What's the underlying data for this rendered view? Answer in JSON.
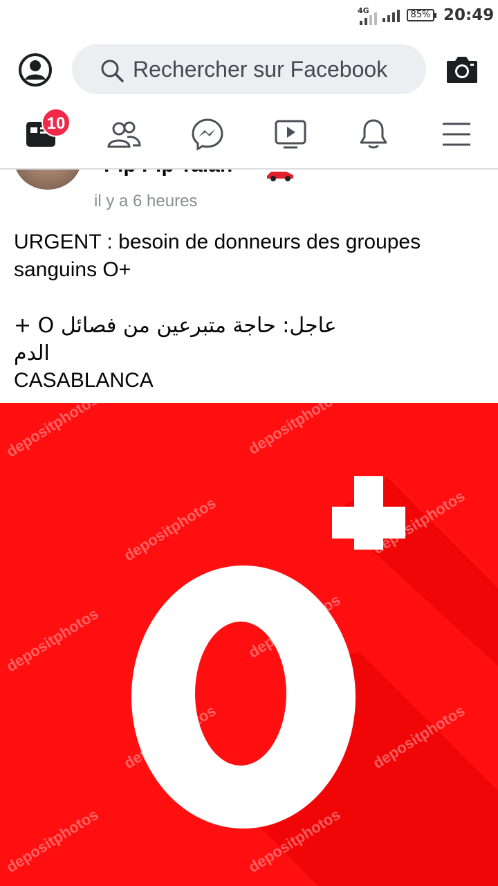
{
  "status_bar": {
    "network": "4G",
    "battery": "85%",
    "time": "20:49"
  },
  "search": {
    "placeholder": "Rechercher sur Facebook"
  },
  "tabs": [
    {
      "name": "feed",
      "icon": "news-feed-icon",
      "badge": "10"
    },
    {
      "name": "friends",
      "icon": "friends-icon"
    },
    {
      "name": "messenger",
      "icon": "messenger-icon"
    },
    {
      "name": "watch",
      "icon": "video-icon"
    },
    {
      "name": "notifications",
      "icon": "bell-icon"
    },
    {
      "name": "menu",
      "icon": "hamburger-menu-icon"
    }
  ],
  "post": {
    "author": "Pip Pip Taian",
    "time": "il y a 6 heures",
    "text_line1": "URGENT : besoin de donneurs des groupes sanguins O+",
    "text_line2": "+ O عاجل: حاجة متبرعين من فصائل الدم",
    "text_line3": "CASABLANCA",
    "image": {
      "main_text": "O",
      "symbol": "+",
      "watermark": "depositphotos",
      "background_color": "#ff0f0f"
    }
  },
  "colors": {
    "badge": "#f02849",
    "icon": "#4b4f56",
    "search_bg": "#eceef2"
  }
}
